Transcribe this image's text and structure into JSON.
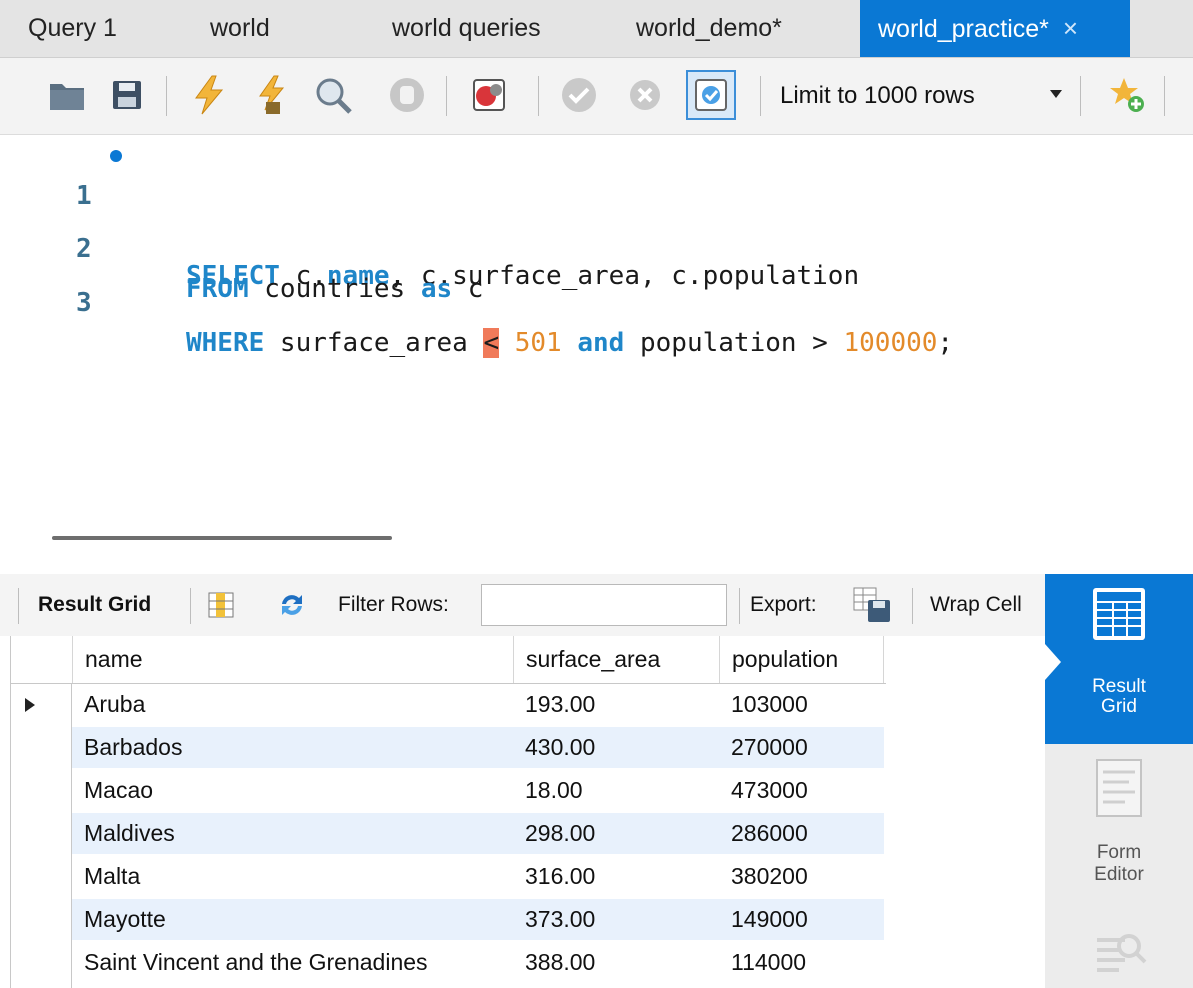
{
  "tabs": [
    "Query 1",
    "world",
    "world queries",
    "world_demo*",
    "world_practice*"
  ],
  "active_tab_close": "×",
  "toolbar": {
    "limit_label": "Limit to 1000 rows"
  },
  "editor": {
    "lines": [
      {
        "num": "1",
        "tokens": [
          {
            "t": "SELECT",
            "c": "kw"
          },
          {
            "t": " c.",
            "c": "pl"
          },
          {
            "t": "name",
            "c": "kw"
          },
          {
            "t": ", c.surface_area, c.population",
            "c": "pl"
          }
        ]
      },
      {
        "num": "2",
        "tokens": [
          {
            "t": "FROM",
            "c": "kw"
          },
          {
            "t": " countries ",
            "c": "pl"
          },
          {
            "t": "as",
            "c": "kw"
          },
          {
            "t": " c",
            "c": "pl"
          }
        ]
      },
      {
        "num": "3",
        "tokens": [
          {
            "t": "WHERE",
            "c": "kw"
          },
          {
            "t": " surface_area ",
            "c": "pl"
          },
          {
            "t": "<",
            "c": "cursor-mark"
          },
          {
            "t": " ",
            "c": "pl"
          },
          {
            "t": "501",
            "c": "num"
          },
          {
            "t": " ",
            "c": "pl"
          },
          {
            "t": "and",
            "c": "kw"
          },
          {
            "t": " population > ",
            "c": "pl"
          },
          {
            "t": "100000",
            "c": "num"
          },
          {
            "t": ";",
            "c": "pl"
          }
        ]
      }
    ]
  },
  "result_toolbar": {
    "result_grid": "Result Grid",
    "filter_rows": "Filter Rows:",
    "export": "Export:",
    "wrap_cell": "Wrap Cell"
  },
  "grid": {
    "columns": [
      "name",
      "surface_area",
      "population"
    ],
    "rows": [
      [
        "Aruba",
        "193.00",
        "103000"
      ],
      [
        "Barbados",
        "430.00",
        "270000"
      ],
      [
        "Macao",
        "18.00",
        "473000"
      ],
      [
        "Maldives",
        "298.00",
        "286000"
      ],
      [
        "Malta",
        "316.00",
        "380200"
      ],
      [
        "Mayotte",
        "373.00",
        "149000"
      ],
      [
        "Saint Vincent and the Grenadines",
        "388.00",
        "114000"
      ]
    ]
  },
  "side_panel": {
    "result_grid": [
      "Result",
      "Grid"
    ],
    "form_editor": [
      "Form",
      "Editor"
    ]
  },
  "colors": {
    "accent": "#0a78d4",
    "keyword": "#1f86c9",
    "number": "#e38a2a",
    "row_alt": "#e8f1fc"
  }
}
